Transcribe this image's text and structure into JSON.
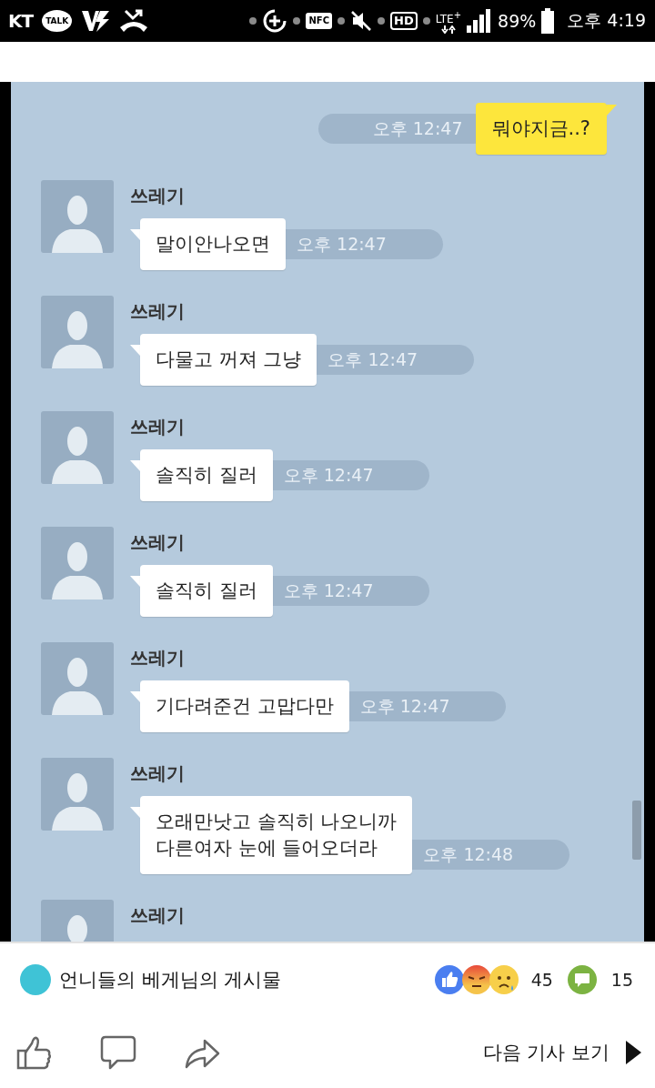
{
  "status_bar": {
    "carrier": "KT",
    "talk_label": "TALK",
    "nfc_label": "NFC",
    "hd_label": "HD",
    "network_label": "LTE$^{+}$",
    "battery": "89%",
    "time": "오후 4:19"
  },
  "chat": {
    "messages": [
      {
        "kind": "sent",
        "text": "뭐야지금..?",
        "time": "오후 12:47"
      },
      {
        "kind": "received",
        "sender": "쓰레기",
        "text": "말이안나오면",
        "time": "오후 12:47"
      },
      {
        "kind": "received",
        "sender": "쓰레기",
        "text": "다물고 꺼져 그냥",
        "time": "오후 12:47"
      },
      {
        "kind": "received",
        "sender": "쓰레기",
        "text": "솔직히 질러",
        "time": "오후 12:47"
      },
      {
        "kind": "received",
        "sender": "쓰레기",
        "text": "솔직히 질러",
        "time": "오후 12:47"
      },
      {
        "kind": "received",
        "sender": "쓰레기",
        "text": "기다려준건 고맙다만",
        "time": "오후 12:47"
      },
      {
        "kind": "received",
        "sender": "쓰레기",
        "text": "오래만낫고 솔직히 나오니까\n다른여자 눈에 들어오더라",
        "time": "오후 12:48"
      },
      {
        "kind": "received",
        "sender": "쓰레기"
      }
    ]
  },
  "post": {
    "page_name": "언니들의 베게님의 게시물",
    "reaction_count": "45",
    "comment_count": "15",
    "next_label": "다음 기사 보기"
  }
}
